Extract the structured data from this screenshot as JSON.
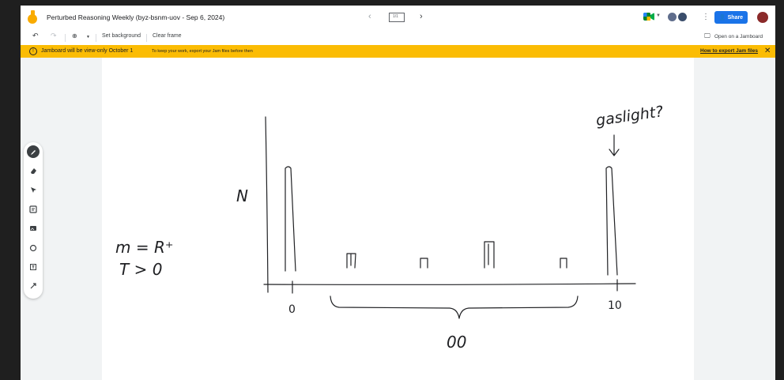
{
  "window": {
    "title": "Perturbed Reasoning Weekly (byz-bsnm-uov - Sep 6, 2024)",
    "frame_indicator": "1/1"
  },
  "header": {
    "share_label": "Share"
  },
  "toolbar": {
    "set_background": "Set background",
    "clear_frame": "Clear frame",
    "open_in_jamboard": "Open on a Jamboard"
  },
  "banner": {
    "title": "Jamboard will be view-only October 1",
    "message": "To keep your work, export your Jam files before then",
    "link": "How to export Jam files"
  },
  "tools": [
    "pen-icon",
    "eraser-icon",
    "select-icon",
    "sticky-note-icon",
    "image-icon",
    "circle-icon",
    "text-box-icon",
    "laser-icon"
  ],
  "colors": {
    "accent": "#1a73e8",
    "banner": "#fbbc04",
    "ink": "#202124"
  },
  "sketch": {
    "y_axis_label": "N",
    "annotation": "gaslight?",
    "left_note_line1": "m = R⁺",
    "left_note_line2": "T > 0",
    "x_tick_start": "0",
    "x_tick_end": "10",
    "brace_label": "00"
  }
}
